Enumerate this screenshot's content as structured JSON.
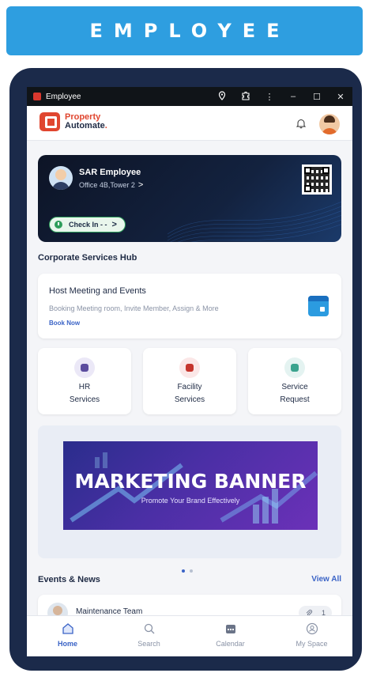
{
  "header": {
    "title": "EMPLOYEE"
  },
  "window": {
    "title": "Employee",
    "controls": [
      "location-icon",
      "puzzle-icon",
      "more-icon",
      "minimize-icon",
      "maximize-icon",
      "close-icon"
    ]
  },
  "app": {
    "logo_line1": "Property",
    "logo_line2": "Automate",
    "logo_dot": ".",
    "profile": {
      "name": "SAR Employee",
      "location": "Office 4B,Tower 2",
      "chevron": ">",
      "checkin_label": "Check In - -",
      "checkin_arrow": ">"
    },
    "hub": {
      "title": "Corporate Services Hub",
      "host_title": "Host Meeting and Events",
      "host_subtitle": "Booking Meeting room, Invite Member, Assign & More",
      "host_link": "Book Now"
    },
    "services": [
      {
        "line1": "HR",
        "line2": "Services"
      },
      {
        "line1": "Facility",
        "line2": "Services"
      },
      {
        "line1": "Service",
        "line2": "Request"
      }
    ],
    "banner": {
      "title": "MARKETING BANNER",
      "subtitle": "Promote Your Brand Effectively"
    },
    "events": {
      "title": "Events & News",
      "view_all": "View All",
      "items": [
        {
          "title": "Maintenance Team",
          "count": "1"
        }
      ]
    },
    "nav": [
      {
        "label": "Home",
        "active": true
      },
      {
        "label": "Search",
        "active": false
      },
      {
        "label": "Calendar",
        "active": false
      },
      {
        "label": "My Space",
        "active": false
      }
    ]
  },
  "colors": {
    "header": "#2e9ee0",
    "device": "#1b2a4a",
    "accent": "#3a63c6",
    "brand": "#e0462f"
  }
}
